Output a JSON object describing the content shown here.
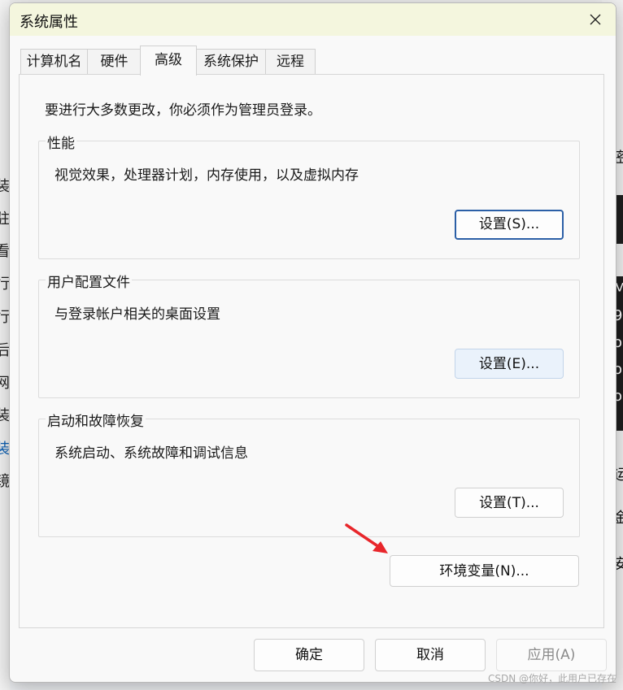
{
  "dialog": {
    "title": "系统属性",
    "tabs": [
      "计算机名",
      "硬件",
      "高级",
      "系统保护",
      "远程"
    ],
    "active_tab": "高级",
    "intro": "要进行大多数更改，你必须作为管理员登录。",
    "groups": [
      {
        "legend": "性能",
        "description": "视觉效果，处理器计划，内存使用，以及虚拟内存",
        "button": "设置(S)..."
      },
      {
        "legend": "用户配置文件",
        "description": "与登录帐户相关的桌面设置",
        "button": "设置(E)..."
      },
      {
        "legend": "启动和故障恢复",
        "description": "系统启动、系统故障和调试信息",
        "button": "设置(T)..."
      }
    ],
    "env_button": "环境变量(N)...",
    "footer": {
      "ok": "确定",
      "cancel": "取消",
      "apply": "应用(A)"
    }
  },
  "background": {
    "left_chars": [
      "装",
      "驻",
      "看",
      "行",
      "行",
      "后",
      "网",
      "装",
      "装",
      "镜"
    ],
    "right_chars": [
      "密",
      "M",
      "9",
      "o",
      "o",
      "o",
      "运",
      "金",
      "安"
    ]
  },
  "watermark": "CSDN @你好，此用户已存在",
  "colors": {
    "title_bg": "#f4f6de",
    "focus_border": "#2b5fa6",
    "arrow": "#e8262b"
  }
}
